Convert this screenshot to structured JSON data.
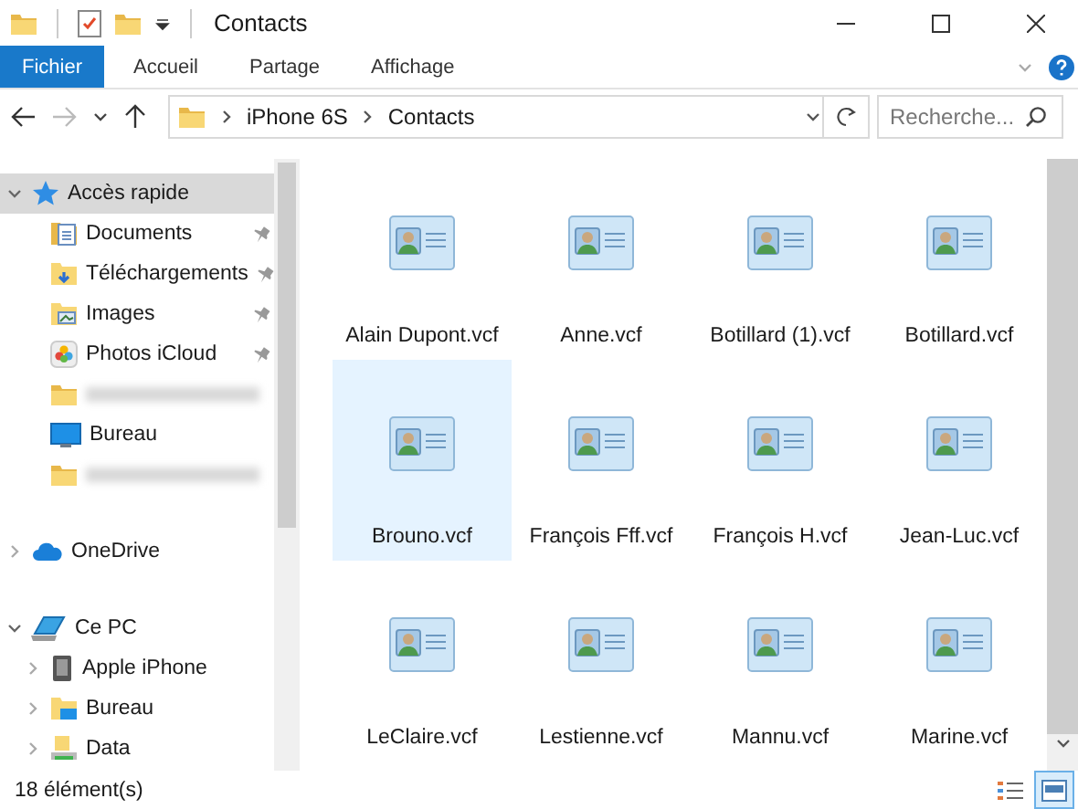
{
  "title_bar": {
    "title": "Contacts"
  },
  "ribbon": {
    "tabs": [
      {
        "label": "Fichier",
        "selected": true
      },
      {
        "label": "Accueil",
        "selected": false
      },
      {
        "label": "Partage",
        "selected": false
      },
      {
        "label": "Affichage",
        "selected": false
      }
    ]
  },
  "address_bar": {
    "path": [
      "iPhone 6S",
      "Contacts"
    ],
    "search": {
      "placeholder": "Recherche..."
    }
  },
  "navigation": {
    "items": [
      {
        "label": "Accès rapide",
        "kind": "star",
        "expanded": true,
        "selected": true,
        "children": [
          {
            "label": "Documents",
            "kind": "documents",
            "pinned": true,
            "selected": false
          },
          {
            "label": "Téléchargements",
            "kind": "downloads",
            "pinned": true,
            "selected": false
          },
          {
            "label": "Images",
            "kind": "images",
            "pinned": true,
            "selected": false
          },
          {
            "label": "Photos iCloud",
            "kind": "photos",
            "pinned": true,
            "selected": false
          },
          {
            "kind": "redacted",
            "selected": false
          },
          {
            "label": "Bureau",
            "kind": "desktop",
            "selected": false
          },
          {
            "kind": "redacted",
            "selected": false
          }
        ]
      },
      {
        "label": "OneDrive",
        "kind": "cloud",
        "expanded": false,
        "selected": false
      },
      {
        "label": "Ce PC",
        "kind": "pc",
        "expanded": true,
        "selected": false,
        "children": [
          {
            "label": "Apple iPhone",
            "kind": "phone",
            "expanded": false,
            "selected": false
          },
          {
            "label": "Bureau",
            "kind": "desktop-folder",
            "expanded": false,
            "selected": false
          },
          {
            "label": "Data",
            "kind": "drive",
            "expanded": false,
            "selected": false
          }
        ]
      }
    ]
  },
  "files": [
    {
      "name": "Alain Dupont.vcf",
      "selected": false
    },
    {
      "name": "Anne.vcf",
      "selected": false
    },
    {
      "name": "Botillard (1).vcf",
      "selected": false
    },
    {
      "name": "Botillard.vcf",
      "selected": false
    },
    {
      "name": "Brouno.vcf",
      "selected": true
    },
    {
      "name": "François Fff.vcf",
      "selected": false
    },
    {
      "name": "François H.vcf",
      "selected": false
    },
    {
      "name": "Jean-Luc.vcf",
      "selected": false
    },
    {
      "name": "LeClaire.vcf",
      "selected": false
    },
    {
      "name": "Lestienne.vcf",
      "selected": false
    },
    {
      "name": "Mannu.vcf",
      "selected": false
    },
    {
      "name": "Marine.vcf",
      "selected": false
    }
  ],
  "status_bar": {
    "count": "18 élément(s)",
    "views": [
      {
        "kind": "details",
        "selected": false
      },
      {
        "kind": "tiles",
        "selected": true
      }
    ]
  }
}
